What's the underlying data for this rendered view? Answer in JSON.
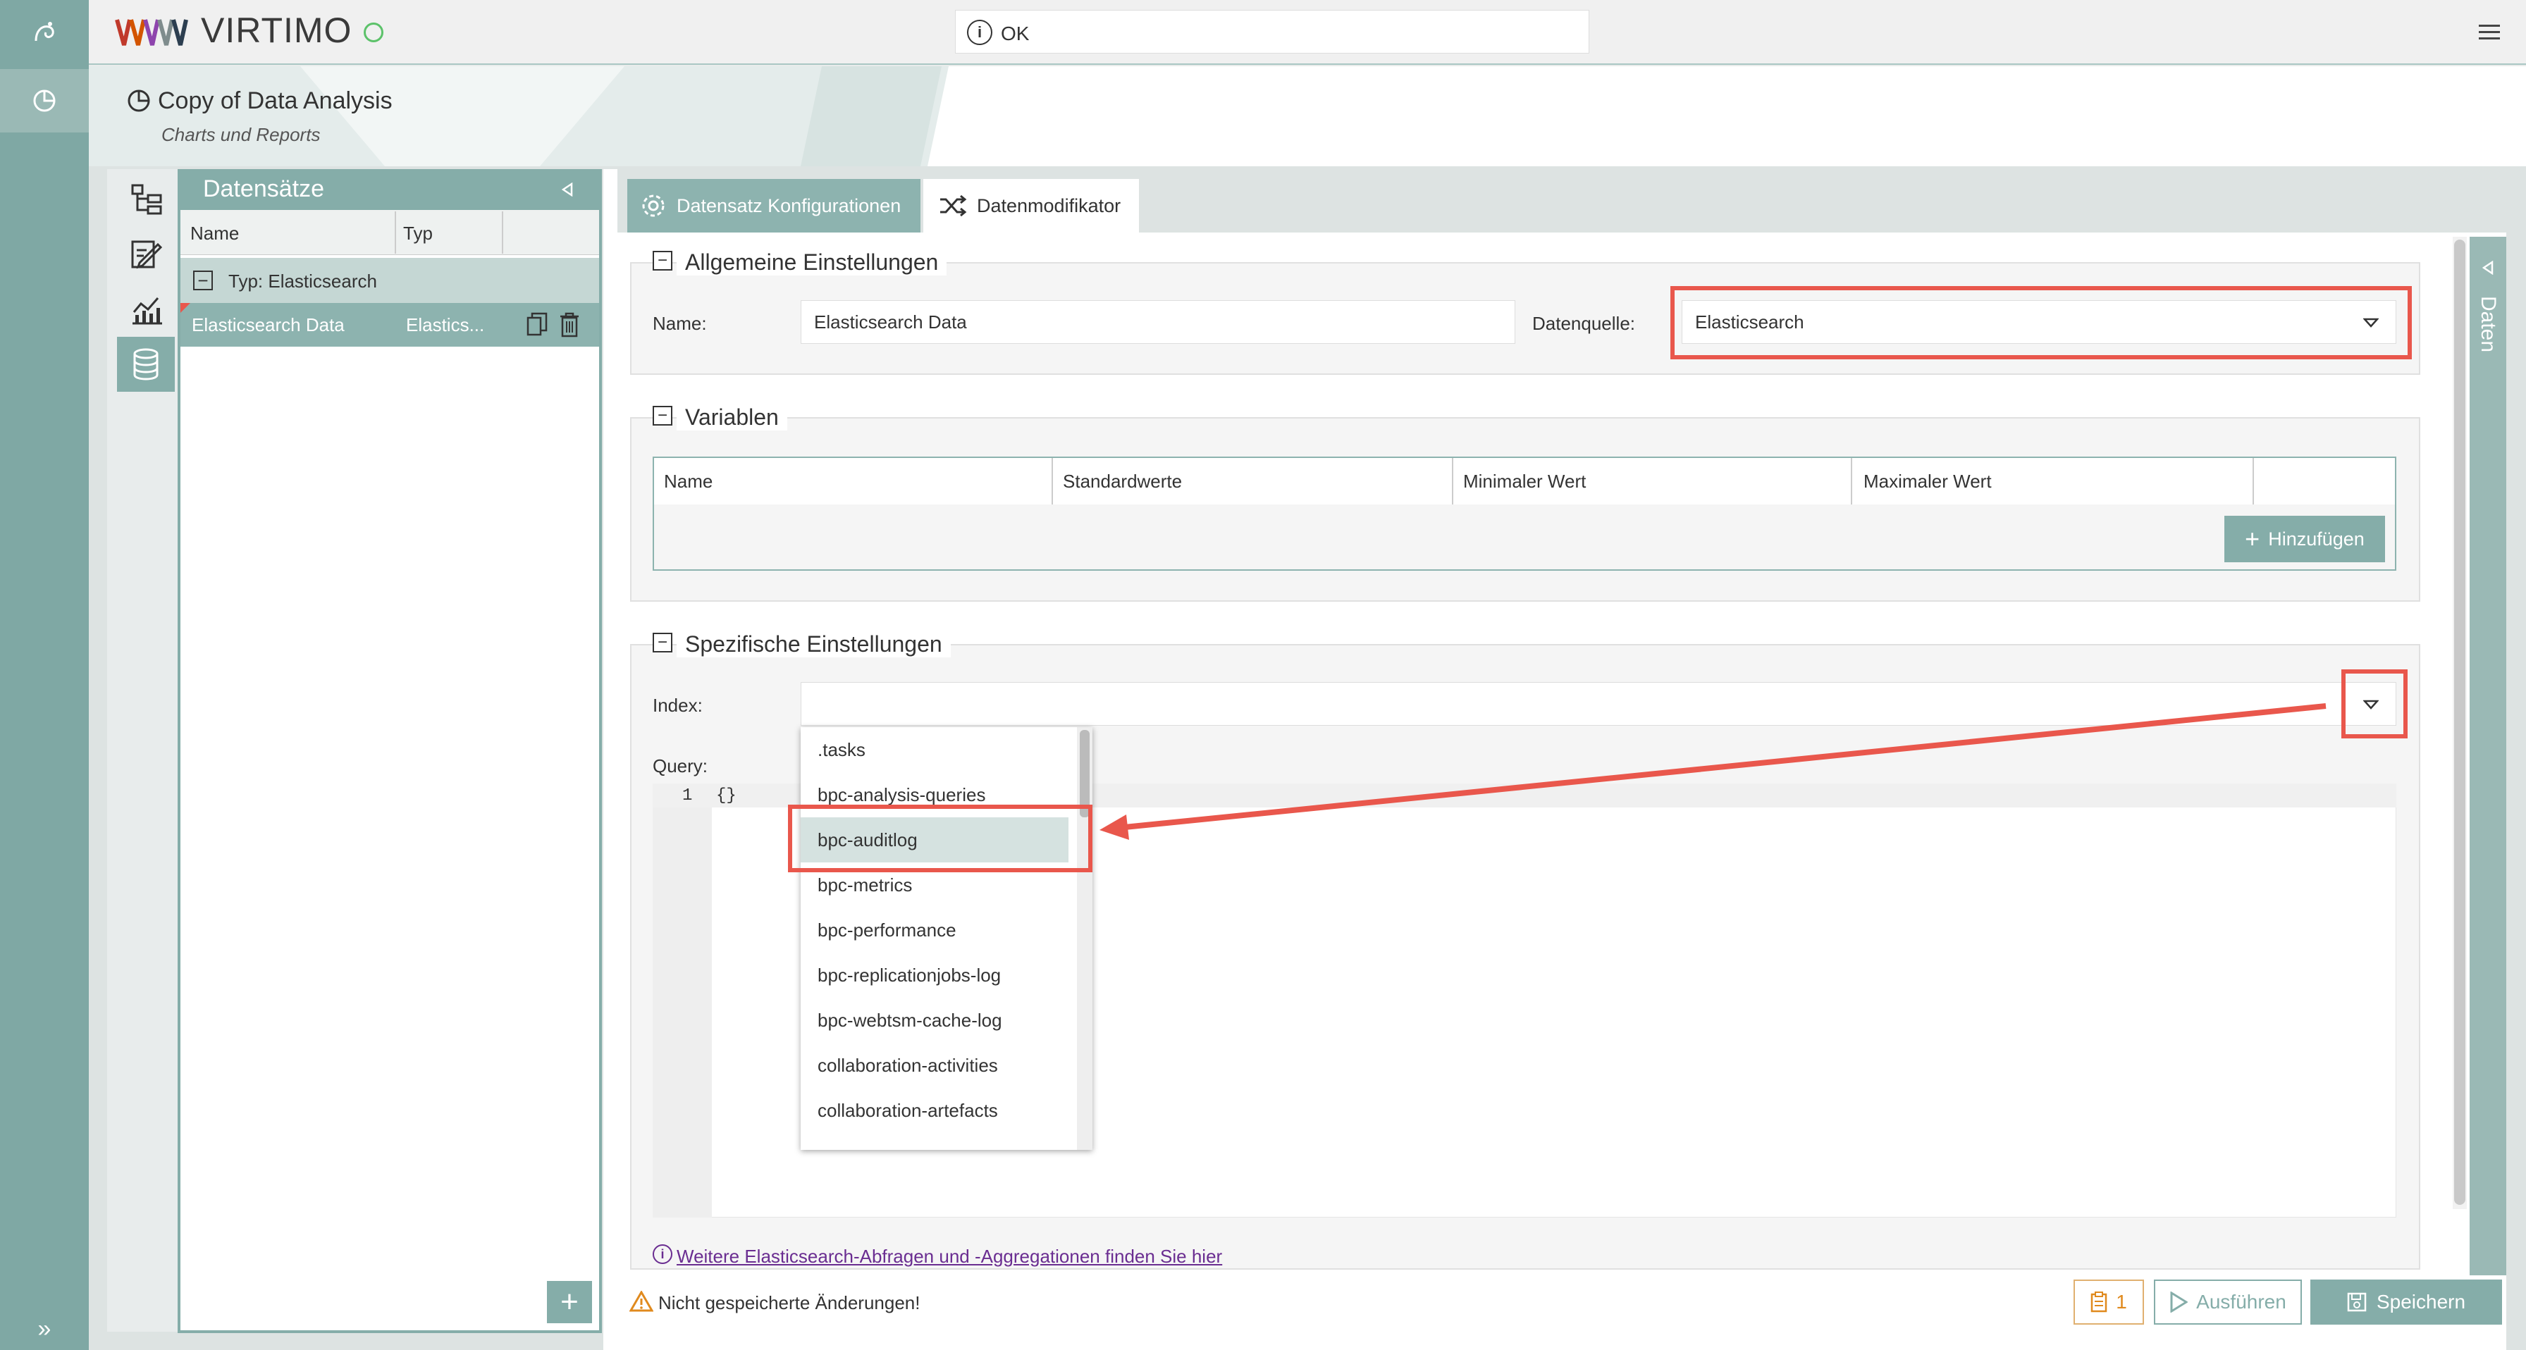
{
  "app": {
    "brand": "VIRTIMO",
    "status_text": "OK"
  },
  "page": {
    "title": "Copy of Data Analysis",
    "subtitle": "Charts und Reports"
  },
  "datasets_panel": {
    "title": "Datensätze",
    "columns": [
      "Name",
      "Typ"
    ],
    "group_label": "Typ: Elasticsearch",
    "rows": [
      {
        "name": "Elasticsearch Data",
        "type": "Elastics..."
      }
    ]
  },
  "tabs": [
    {
      "label": "Datensatz Konfigurationen"
    },
    {
      "label": "Datenmodifikator"
    }
  ],
  "general": {
    "legend": "Allgemeine Einstellungen",
    "name_label": "Name:",
    "name_value": "Elasticsearch Data",
    "source_label": "Datenquelle:",
    "source_value": "Elasticsearch"
  },
  "variables": {
    "legend": "Variablen",
    "columns": [
      "Name",
      "Standardwerte",
      "Minimaler Wert",
      "Maximaler Wert"
    ],
    "add_label": "Hinzufügen"
  },
  "specific": {
    "legend": "Spezifische Einstellungen",
    "index_label": "Index:",
    "index_value": "",
    "query_label": "Query:",
    "query_line_no": "1",
    "query_text": "{}",
    "index_options": [
      ".tasks",
      "bpc-analysis-queries",
      "bpc-auditlog",
      "bpc-metrics",
      "bpc-performance",
      "bpc-replicationjobs-log",
      "bpc-webtsm-cache-log",
      "collaboration-activities",
      "collaboration-artefacts"
    ],
    "highlighted_option": "bpc-auditlog",
    "help_link": "Weitere Elasticsearch-Abfragen und -Aggregationen finden Sie hier"
  },
  "footer": {
    "unsaved_text": "Nicht gespeicherte Änderungen!",
    "count": "1",
    "run_label": "Ausführen",
    "save_label": "Speichern"
  },
  "right_panel": {
    "label": "Daten"
  },
  "colors": {
    "accent": "#85ada9",
    "highlight": "#e9574c",
    "link": "#6a2d91"
  }
}
